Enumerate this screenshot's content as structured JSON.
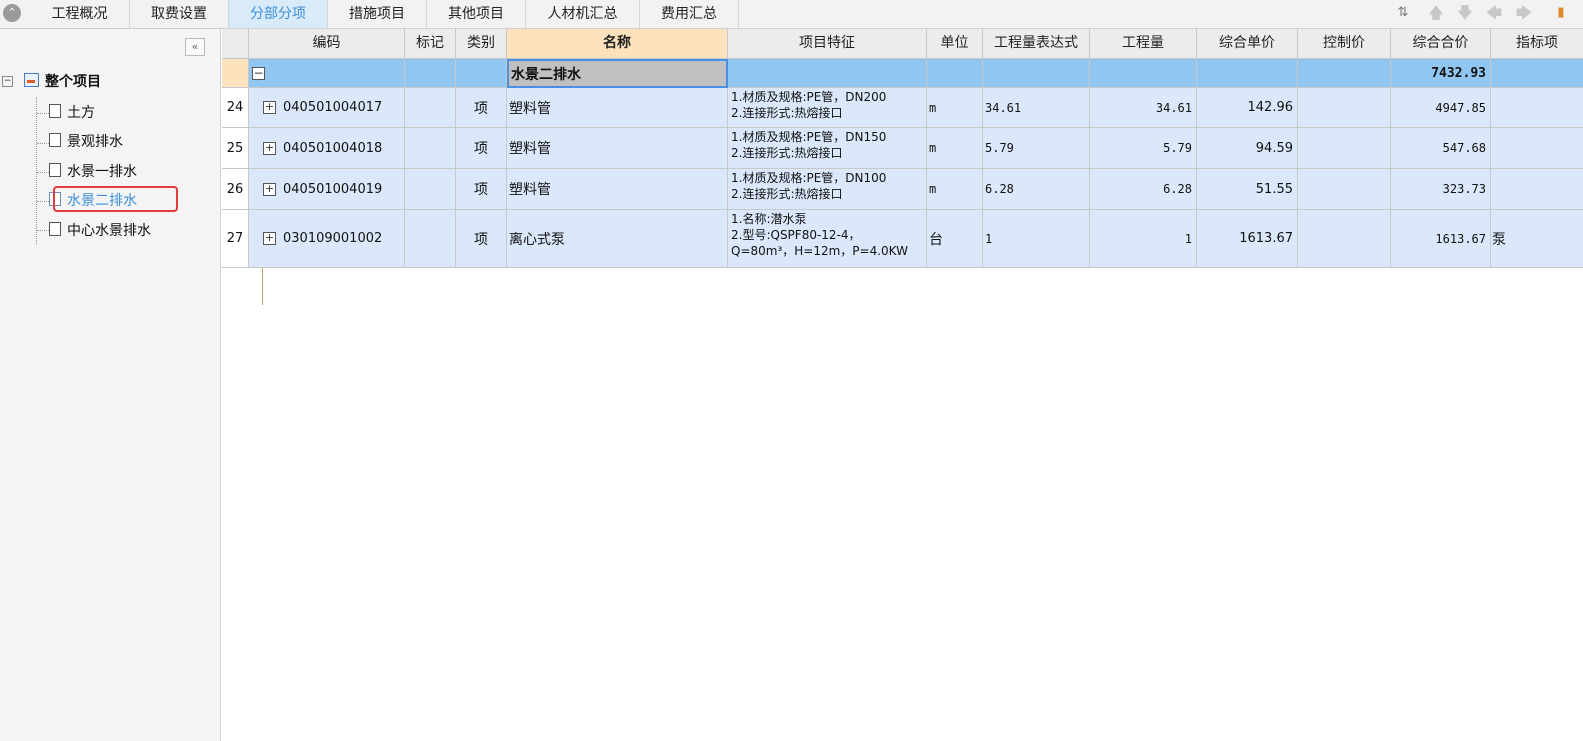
{
  "tabs": [
    {
      "label": "工程概况",
      "active": false
    },
    {
      "label": "取费设置",
      "active": false
    },
    {
      "label": "分部分项",
      "active": true
    },
    {
      "label": "措施项目",
      "active": false
    },
    {
      "label": "其他项目",
      "active": false
    },
    {
      "label": "人材机汇总",
      "active": false
    },
    {
      "label": "费用汇总",
      "active": false
    }
  ],
  "toolbar_icons": [
    "sort-icon",
    "move-up-icon",
    "move-down-icon",
    "move-left-icon",
    "move-right-icon"
  ],
  "sidebar": {
    "root_label": "整个项目",
    "items": [
      {
        "label": "土方"
      },
      {
        "label": "景观排水"
      },
      {
        "label": "水景一排水"
      },
      {
        "label": "水景二排水",
        "selected": true
      },
      {
        "label": "中心水景排水"
      }
    ]
  },
  "grid": {
    "headers": {
      "code": "编码",
      "mark": "标记",
      "type": "类别",
      "name": "名称",
      "feature": "项目特征",
      "unit": "单位",
      "expr": "工程量表达式",
      "qty": "工程量",
      "unit_price": "综合单价",
      "ctrl_price": "控制价",
      "total": "综合合价",
      "indicator": "指标项"
    },
    "group": {
      "name": "水景二排水",
      "total": "7432.93"
    },
    "rows": [
      {
        "num": "24",
        "code": "040501004017",
        "type": "项",
        "name": "塑料管",
        "feature": [
          "1.材质及规格:PE管，DN200",
          "2.连接形式:热熔接口"
        ],
        "unit": "m",
        "expr": "34.61",
        "qty": "34.61",
        "unit_price": "142.96",
        "total": "4947.85",
        "indicator": ""
      },
      {
        "num": "25",
        "code": "040501004018",
        "type": "项",
        "name": "塑料管",
        "feature": [
          "1.材质及规格:PE管，DN150",
          "2.连接形式:热熔接口"
        ],
        "unit": "m",
        "expr": "5.79",
        "qty": "5.79",
        "unit_price": "94.59",
        "total": "547.68",
        "indicator": ""
      },
      {
        "num": "26",
        "code": "040501004019",
        "type": "项",
        "name": "塑料管",
        "feature": [
          "1.材质及规格:PE管，DN100",
          "2.连接形式:热熔接口"
        ],
        "unit": "m",
        "expr": "6.28",
        "qty": "6.28",
        "unit_price": "51.55",
        "total": "323.73",
        "indicator": ""
      },
      {
        "num": "27",
        "code": "030109001002",
        "type": "项",
        "name": "离心式泵",
        "feature": [
          "1.名称:潜水泵",
          "2.型号:QSPF80-12-4，",
          "Q=80m³，H=12m，P=4.0KW"
        ],
        "unit": "台",
        "expr": "1",
        "qty": "1",
        "unit_price": "1613.67",
        "total": "1613.67",
        "indicator": "泵"
      }
    ]
  },
  "colors": {
    "active_tab": "#3d8fdb",
    "group_row": "#91c6f1",
    "data_row": "#dbe8fb",
    "highlight": "#e03a3a"
  }
}
